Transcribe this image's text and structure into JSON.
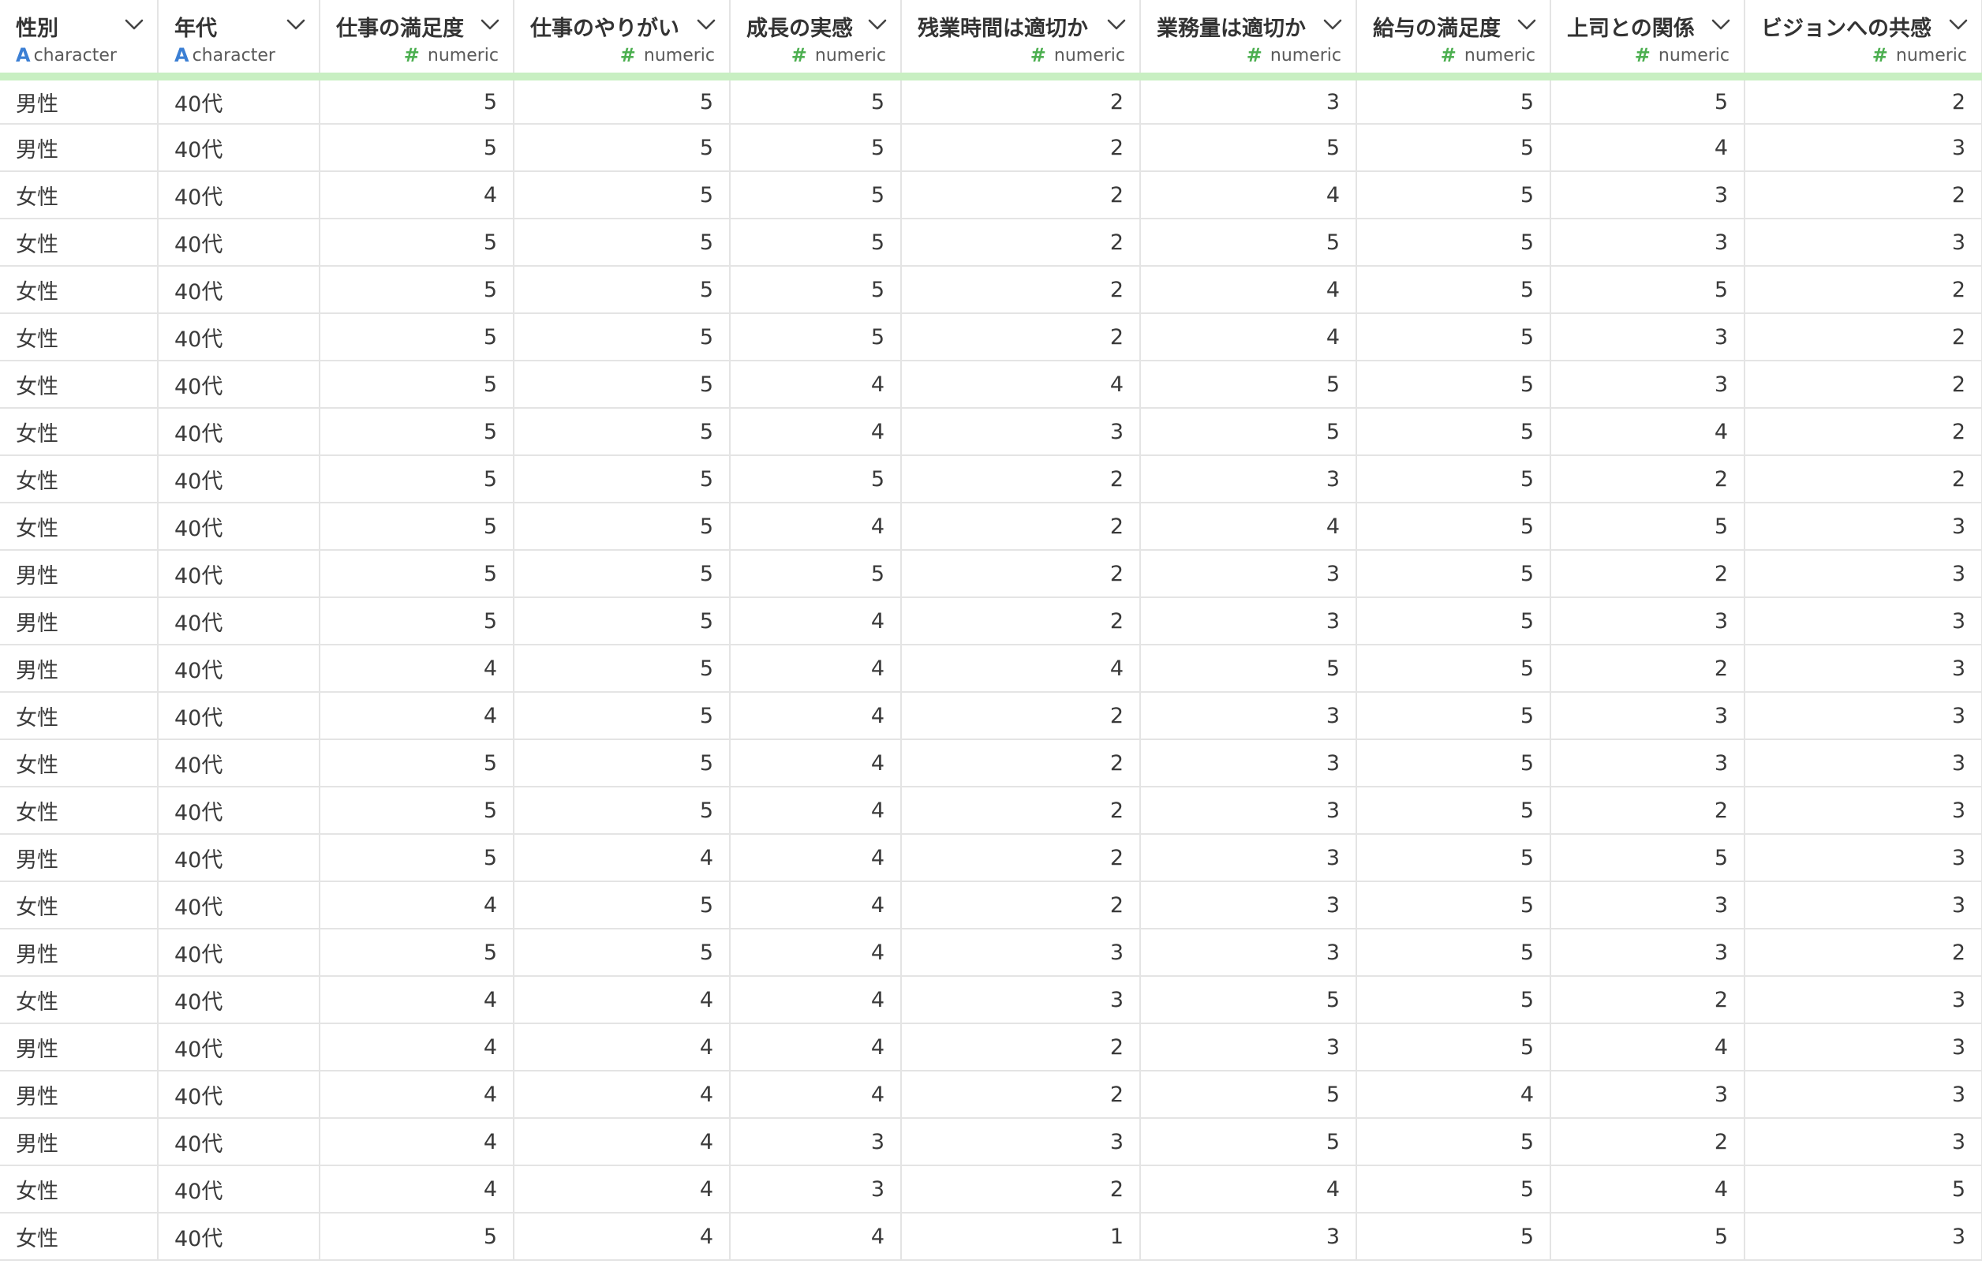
{
  "columns": [
    {
      "name": "性別",
      "type": "character",
      "icon": "A",
      "kind": "text"
    },
    {
      "name": "年代",
      "type": "character",
      "icon": "A",
      "kind": "text"
    },
    {
      "name": "仕事の満足度",
      "type": "numeric",
      "icon": "#",
      "kind": "num"
    },
    {
      "name": "仕事のやりがい",
      "type": "numeric",
      "icon": "#",
      "kind": "num"
    },
    {
      "name": "成長の実感",
      "type": "numeric",
      "icon": "#",
      "kind": "num"
    },
    {
      "name": "残業時間は適切か",
      "type": "numeric",
      "icon": "#",
      "kind": "num"
    },
    {
      "name": "業務量は適切か",
      "type": "numeric",
      "icon": "#",
      "kind": "num"
    },
    {
      "name": "給与の満足度",
      "type": "numeric",
      "icon": "#",
      "kind": "num"
    },
    {
      "name": "上司との関係",
      "type": "numeric",
      "icon": "#",
      "kind": "num"
    },
    {
      "name": "ビジョンへの共感",
      "type": "numeric",
      "icon": "#",
      "kind": "num"
    }
  ],
  "rows": [
    [
      "男性",
      "40代",
      "5",
      "5",
      "5",
      "2",
      "3",
      "5",
      "5",
      "2"
    ],
    [
      "男性",
      "40代",
      "5",
      "5",
      "5",
      "2",
      "5",
      "5",
      "4",
      "3"
    ],
    [
      "女性",
      "40代",
      "4",
      "5",
      "5",
      "2",
      "4",
      "5",
      "3",
      "2"
    ],
    [
      "女性",
      "40代",
      "5",
      "5",
      "5",
      "2",
      "5",
      "5",
      "3",
      "3"
    ],
    [
      "女性",
      "40代",
      "5",
      "5",
      "5",
      "2",
      "4",
      "5",
      "5",
      "2"
    ],
    [
      "女性",
      "40代",
      "5",
      "5",
      "5",
      "2",
      "4",
      "5",
      "3",
      "2"
    ],
    [
      "女性",
      "40代",
      "5",
      "5",
      "4",
      "4",
      "5",
      "5",
      "3",
      "2"
    ],
    [
      "女性",
      "40代",
      "5",
      "5",
      "4",
      "3",
      "5",
      "5",
      "4",
      "2"
    ],
    [
      "女性",
      "40代",
      "5",
      "5",
      "5",
      "2",
      "3",
      "5",
      "2",
      "2"
    ],
    [
      "女性",
      "40代",
      "5",
      "5",
      "4",
      "2",
      "4",
      "5",
      "5",
      "3"
    ],
    [
      "男性",
      "40代",
      "5",
      "5",
      "5",
      "2",
      "3",
      "5",
      "2",
      "3"
    ],
    [
      "男性",
      "40代",
      "5",
      "5",
      "4",
      "2",
      "3",
      "5",
      "3",
      "3"
    ],
    [
      "男性",
      "40代",
      "4",
      "5",
      "4",
      "4",
      "5",
      "5",
      "2",
      "3"
    ],
    [
      "女性",
      "40代",
      "4",
      "5",
      "4",
      "2",
      "3",
      "5",
      "3",
      "3"
    ],
    [
      "女性",
      "40代",
      "5",
      "5",
      "4",
      "2",
      "3",
      "5",
      "3",
      "3"
    ],
    [
      "女性",
      "40代",
      "5",
      "5",
      "4",
      "2",
      "3",
      "5",
      "2",
      "3"
    ],
    [
      "男性",
      "40代",
      "5",
      "4",
      "4",
      "2",
      "3",
      "5",
      "5",
      "3"
    ],
    [
      "女性",
      "40代",
      "4",
      "5",
      "4",
      "2",
      "3",
      "5",
      "3",
      "3"
    ],
    [
      "男性",
      "40代",
      "5",
      "5",
      "4",
      "3",
      "3",
      "5",
      "3",
      "2"
    ],
    [
      "女性",
      "40代",
      "4",
      "4",
      "4",
      "3",
      "5",
      "5",
      "2",
      "3"
    ],
    [
      "男性",
      "40代",
      "4",
      "4",
      "4",
      "2",
      "3",
      "5",
      "4",
      "3"
    ],
    [
      "男性",
      "40代",
      "4",
      "4",
      "4",
      "2",
      "5",
      "4",
      "3",
      "3"
    ],
    [
      "男性",
      "40代",
      "4",
      "4",
      "3",
      "3",
      "5",
      "5",
      "2",
      "3"
    ],
    [
      "女性",
      "40代",
      "4",
      "4",
      "3",
      "2",
      "4",
      "5",
      "4",
      "5"
    ],
    [
      "女性",
      "40代",
      "5",
      "4",
      "4",
      "1",
      "3",
      "5",
      "5",
      "3"
    ]
  ],
  "colors": {
    "header_underline": "#c8efc2",
    "character_icon": "#3b7fd4",
    "numeric_icon": "#4caf50",
    "grid_line": "#e4e4e4"
  }
}
